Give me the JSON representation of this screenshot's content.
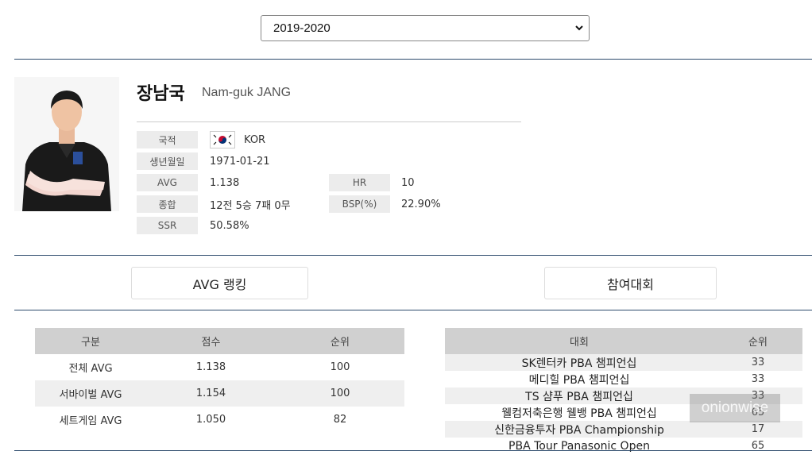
{
  "season_select": {
    "selected": "2019-2020"
  },
  "player": {
    "name_ko": "장남국",
    "name_en": "Nam-guk JANG",
    "nationality_label": "국적",
    "nationality": "KOR",
    "birth_label": "생년월일",
    "birth": "1971-01-21",
    "avg_label": "AVG",
    "avg": "1.138",
    "hr_label": "HR",
    "hr": "10",
    "record_label": "종합",
    "record": "12전 5승 7패 0무",
    "bsp_label": "BSP(%)",
    "bsp": "22.90%",
    "ssr_label": "SSR",
    "ssr": "50.58%"
  },
  "tabs": {
    "avg_ranking": "AVG 랭킹",
    "tournaments": "참여대회"
  },
  "avg_table": {
    "headers": [
      "구분",
      "점수",
      "순위"
    ],
    "rows": [
      [
        "전체 AVG",
        "1.138",
        "100"
      ],
      [
        "서바이벌 AVG",
        "1.154",
        "100"
      ],
      [
        "세트게임 AVG",
        "1.050",
        "82"
      ]
    ]
  },
  "tour_table": {
    "headers": [
      "대회",
      "순위"
    ],
    "rows": [
      [
        "SK렌터카 PBA 챔피언십",
        "33"
      ],
      [
        "메디힐 PBA 챔피언십",
        "33"
      ],
      [
        "TS 샴푸 PBA 챔피언십",
        "33"
      ],
      [
        "웰컴저축은행 웰뱅 PBA 챔피언십",
        "65"
      ],
      [
        "신한금융투자 PBA Championship",
        "17"
      ],
      [
        "PBA Tour Panasonic Open",
        "65"
      ]
    ]
  },
  "watermark": "onionwise",
  "colors": {
    "rule": "#2c4a6b",
    "header_bg": "#d0d0d0",
    "label_bg": "#ececec"
  }
}
